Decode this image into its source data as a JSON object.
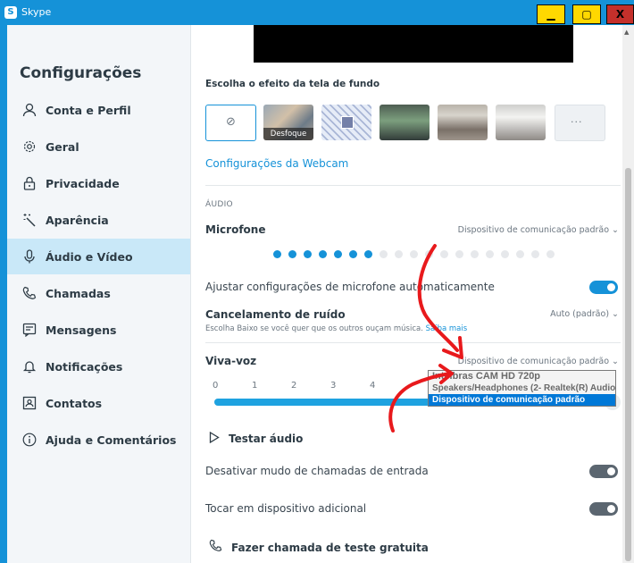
{
  "titlebar": {
    "logo": "S",
    "title": "Skype",
    "min": "▁",
    "max": "▢",
    "close": "X"
  },
  "sidebar": {
    "title": "Configurações",
    "items": [
      {
        "label": "Conta e Perfil",
        "icon": "person-icon"
      },
      {
        "label": "Geral",
        "icon": "gear-icon"
      },
      {
        "label": "Privacidade",
        "icon": "lock-icon"
      },
      {
        "label": "Aparência",
        "icon": "magic-wand-icon"
      },
      {
        "label": "Áudio e Vídeo",
        "icon": "microphone-icon",
        "active": true
      },
      {
        "label": "Chamadas",
        "icon": "phone-icon"
      },
      {
        "label": "Mensagens",
        "icon": "message-icon"
      },
      {
        "label": "Notificações",
        "icon": "bell-icon"
      },
      {
        "label": "Contatos",
        "icon": "contact-card-icon"
      },
      {
        "label": "Ajuda e Comentários",
        "icon": "info-icon"
      }
    ]
  },
  "video": {
    "background_label": "Escolha o efeito da tela de fundo",
    "blur_caption": "Desfoque",
    "more": "···",
    "webcam_link": "Configurações da Webcam"
  },
  "audio": {
    "section_title": "ÁUDIO",
    "microphone": {
      "label": "Microfone",
      "value": "Dispositivo de comunicação padrão ⌄",
      "level_on": 7,
      "level_total": 19
    },
    "auto_adjust": {
      "label": "Ajustar configurações de microfone automaticamente",
      "on": true
    },
    "noise": {
      "label": "Cancelamento de ruído",
      "value": "Auto (padrão) ⌄",
      "sub": "Escolha Baixo se você quer que os outros ouçam música.",
      "sub_link": "Saiba mais"
    },
    "speaker": {
      "label": "Viva-voz",
      "value": "Dispositivo de comunicação padrão ⌄",
      "ticks": [
        "0",
        "1",
        "2",
        "3",
        "4"
      ],
      "volume": 0.96
    },
    "dropdown_options": [
      "Intelbras CAM HD 720p",
      "Speakers/Headphones (2- Realtek(R) Audio)",
      "Dispositivo de comunicação padrão"
    ],
    "test_audio": "Testar áudio",
    "mute_incoming": {
      "label": "Desativar mudo de chamadas de entrada",
      "on": false
    },
    "ring_additional": {
      "label": "Tocar em dispositivo adicional",
      "on": false
    },
    "free_test_call": "Fazer chamada de teste gratuita"
  },
  "colors": {
    "accent": "#1592d8",
    "annotation": "#e8191c"
  }
}
